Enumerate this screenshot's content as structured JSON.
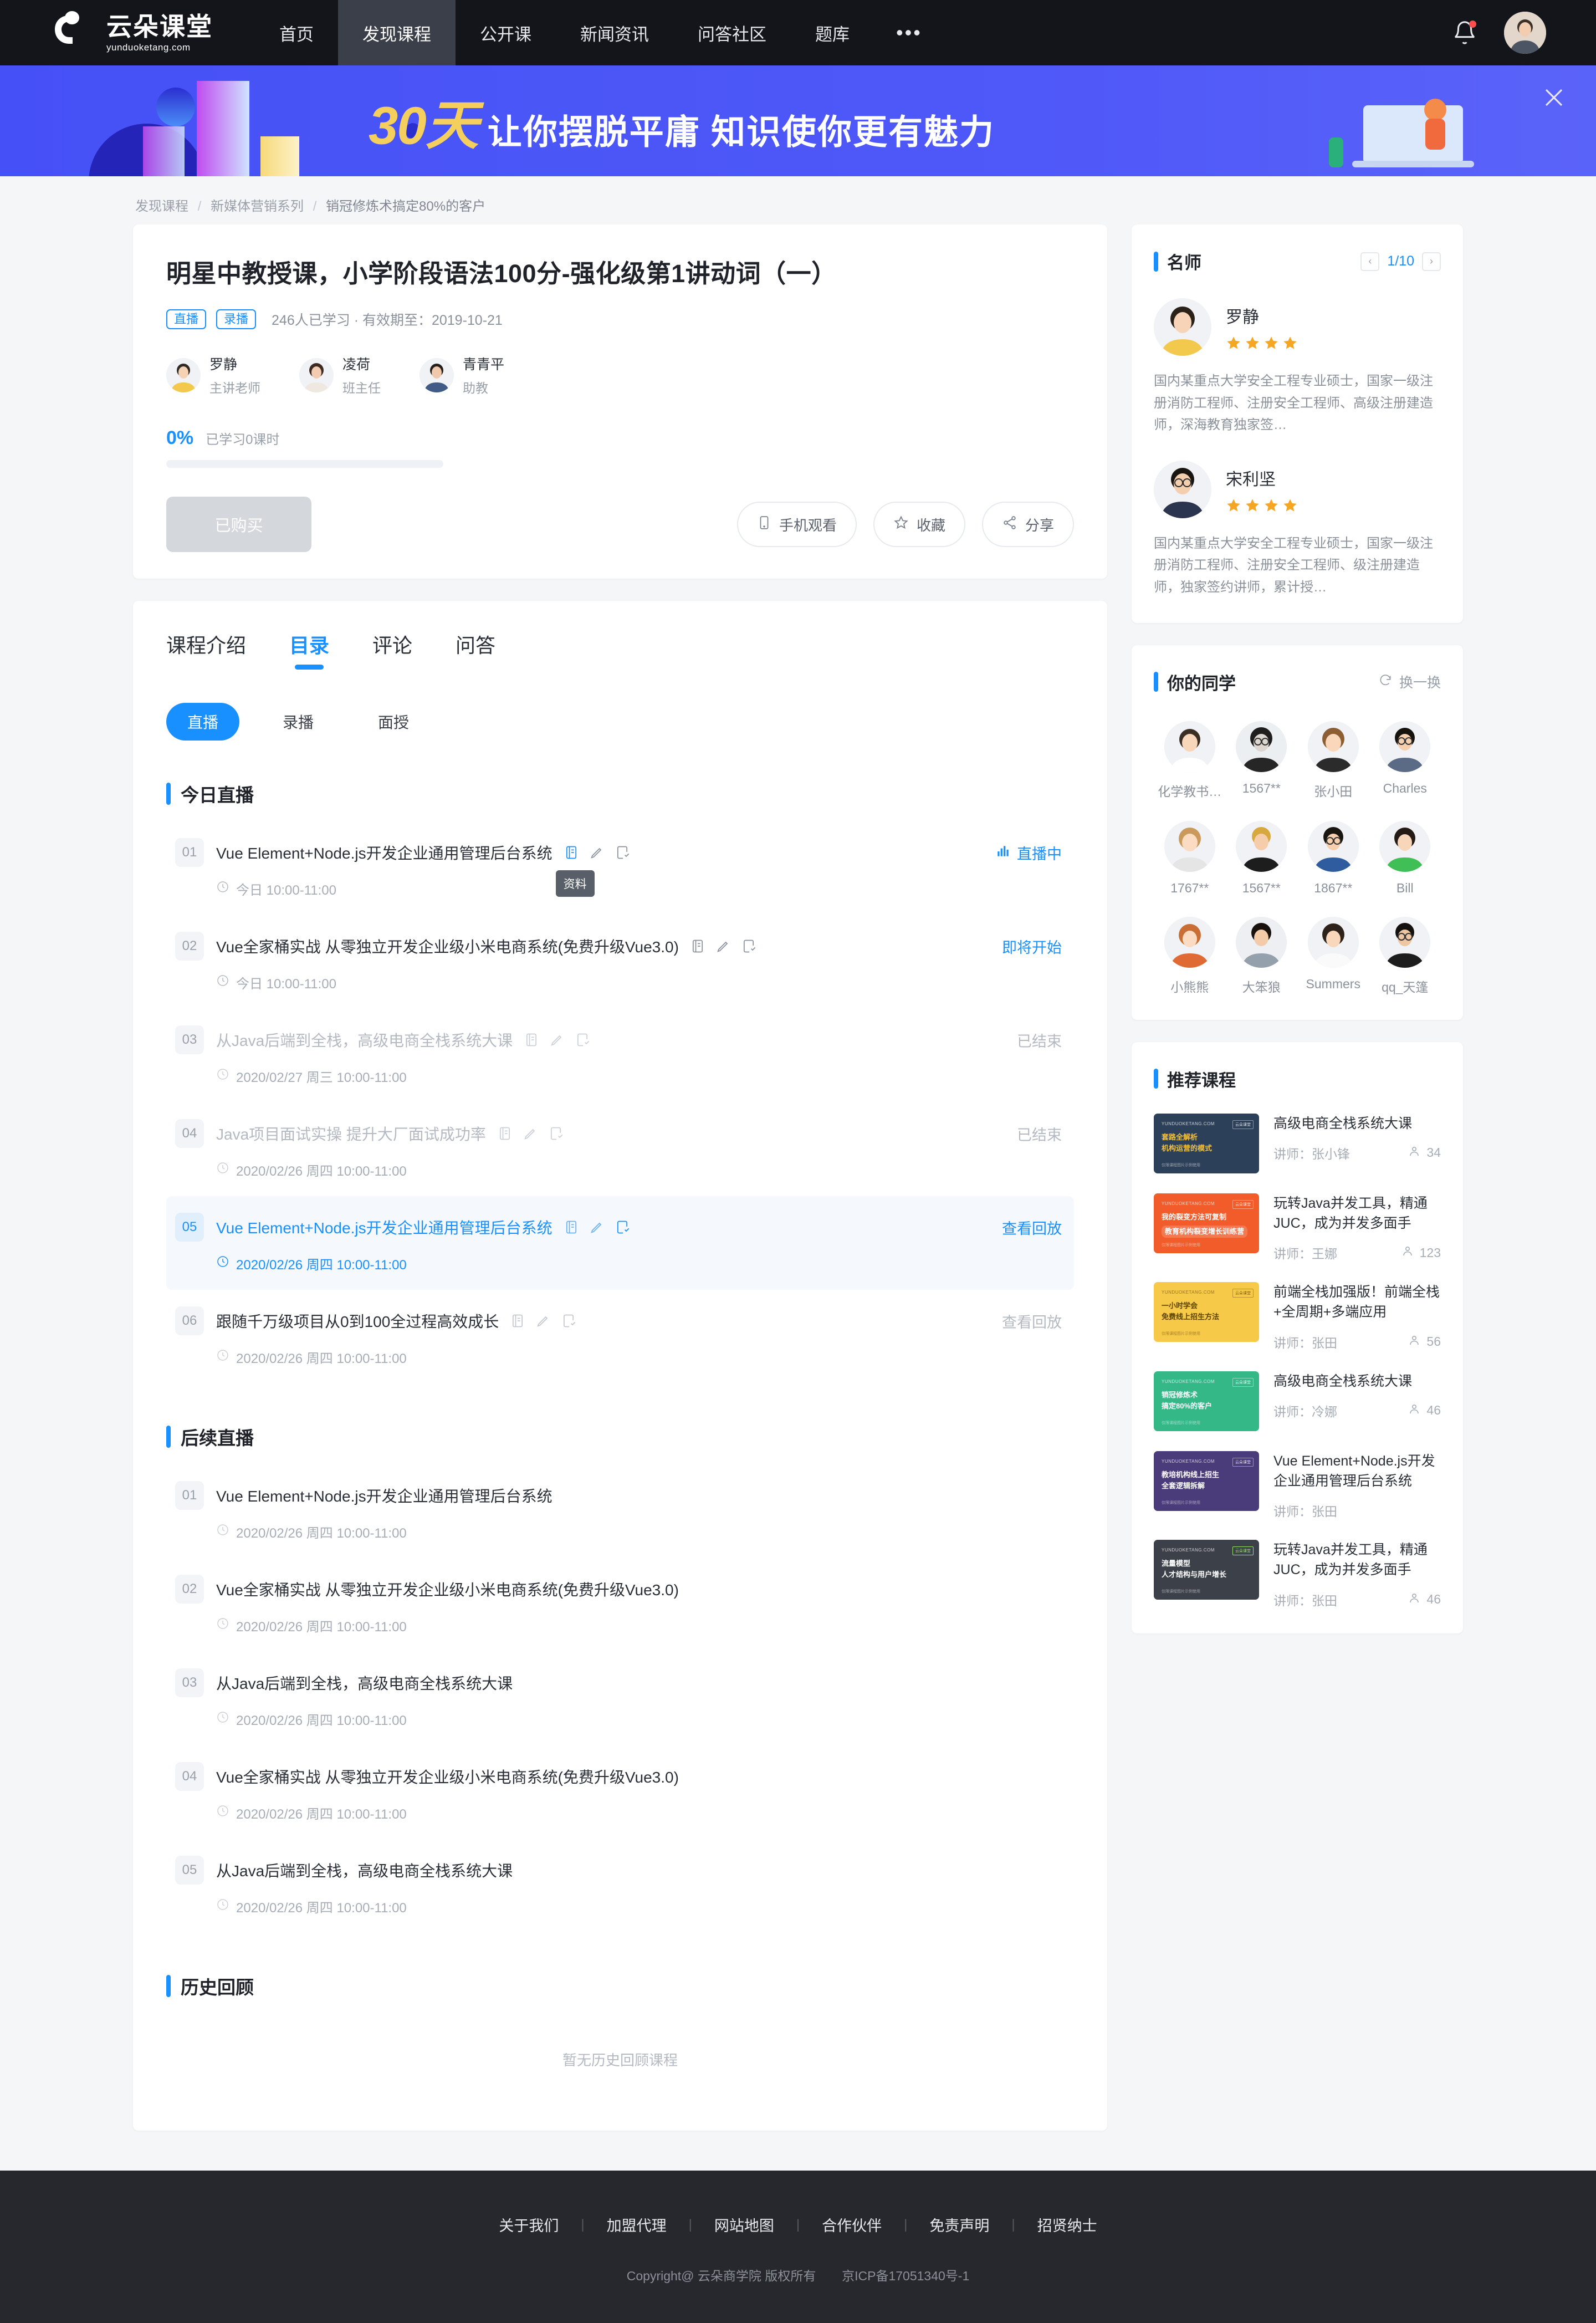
{
  "header": {
    "logo_cn": "云朵课堂",
    "logo_en": "yunduoketang.com",
    "nav": [
      {
        "label": "首页",
        "active": false
      },
      {
        "label": "发现课程",
        "active": true
      },
      {
        "label": "公开课",
        "active": false
      },
      {
        "label": "新闻资讯",
        "active": false
      },
      {
        "label": "问答社区",
        "active": false
      },
      {
        "label": "题库",
        "active": false
      }
    ],
    "more_label": "•••",
    "bell_icon": "bell-icon",
    "avatar_icon": "user-avatar"
  },
  "banner": {
    "highlight": "30天",
    "text": "让你摆脱平庸 知识使你更有魅力",
    "close_icon": "close-icon"
  },
  "breadcrumb": {
    "items": [
      "发现课程",
      "新媒体营销系列",
      "销冠修炼术搞定80%的客户"
    ]
  },
  "course": {
    "title": "明星中教授课，小学阶段语法100分-强化级第1讲动词（一）",
    "tags": [
      "直播",
      "录播"
    ],
    "meta": "246人已学习 · 有效期至：2019-10-21",
    "teachers": [
      {
        "name": "罗静",
        "role": "主讲老师"
      },
      {
        "name": "凌荷",
        "role": "班主任"
      },
      {
        "name": "青青平",
        "role": "助教"
      }
    ],
    "progress_pct": "0%",
    "progress_label": "已学习0课时",
    "progress_value": 0,
    "buy_button": "已购买",
    "actions": [
      {
        "label": "手机观看",
        "icon": "mobile-icon"
      },
      {
        "label": "收藏",
        "icon": "star-icon"
      },
      {
        "label": "分享",
        "icon": "share-icon"
      }
    ]
  },
  "catalog": {
    "tabs": [
      {
        "label": "课程介绍",
        "active": false
      },
      {
        "label": "目录",
        "active": true
      },
      {
        "label": "评论",
        "active": false
      },
      {
        "label": "问答",
        "active": false
      }
    ],
    "pills": [
      {
        "label": "直播",
        "active": true
      },
      {
        "label": "录播",
        "active": false
      },
      {
        "label": "面授",
        "active": false
      }
    ],
    "tooltip": "资料",
    "sections": [
      {
        "title": "今日直播",
        "lessons": [
          {
            "no": "01",
            "title": "Vue Element+Node.js开发企业通用管理后台系统",
            "time": "今日 10:00-11:00",
            "status": "直播中",
            "status_type": "live",
            "icons": true,
            "state": "normal",
            "tooltip": true
          },
          {
            "no": "02",
            "title": "Vue全家桶实战 从零独立开发企业级小米电商系统(免费升级Vue3.0)",
            "time": "今日 10:00-11:00",
            "status": "即将开始",
            "status_type": "soon",
            "icons": true,
            "state": "normal",
            "tooltip": false
          },
          {
            "no": "03",
            "title": "从Java后端到全栈，高级电商全栈系统大课",
            "time": "2020/02/27 周三 10:00-11:00",
            "status": "已结束",
            "status_type": "end",
            "icons": true,
            "state": "muted",
            "tooltip": false
          },
          {
            "no": "04",
            "title": "Java项目面试实操 提升大厂面试成功率",
            "time": "2020/02/26 周四 10:00-11:00",
            "status": "已结束",
            "status_type": "end",
            "icons": true,
            "state": "muted",
            "tooltip": false
          },
          {
            "no": "05",
            "title": "Vue Element+Node.js开发企业通用管理后台系统",
            "time": "2020/02/26 周四 10:00-11:00",
            "status": "查看回放",
            "status_type": "replay",
            "icons": true,
            "state": "hl",
            "tooltip": false
          },
          {
            "no": "06",
            "title": "跟随千万级项目从0到100全过程高效成长",
            "time": "2020/02/26 周四 10:00-11:00",
            "status": "查看回放",
            "status_type": "replay",
            "icons": true,
            "state": "normal",
            "tooltip": false
          }
        ]
      },
      {
        "title": "后续直播",
        "lessons": [
          {
            "no": "01",
            "title": "Vue Element+Node.js开发企业通用管理后台系统",
            "time": "2020/02/26 周四 10:00-11:00",
            "status": "",
            "status_type": "none",
            "icons": false,
            "state": "normal",
            "tooltip": false
          },
          {
            "no": "02",
            "title": "Vue全家桶实战 从零独立开发企业级小米电商系统(免费升级Vue3.0)",
            "time": "2020/02/26 周四 10:00-11:00",
            "status": "",
            "status_type": "none",
            "icons": false,
            "state": "normal",
            "tooltip": false
          },
          {
            "no": "03",
            "title": "从Java后端到全栈，高级电商全栈系统大课",
            "time": "2020/02/26 周四 10:00-11:00",
            "status": "",
            "status_type": "none",
            "icons": false,
            "state": "normal",
            "tooltip": false
          },
          {
            "no": "04",
            "title": "Vue全家桶实战 从零独立开发企业级小米电商系统(免费升级Vue3.0)",
            "time": "2020/02/26 周四 10:00-11:00",
            "status": "",
            "status_type": "none",
            "icons": false,
            "state": "normal",
            "tooltip": false
          },
          {
            "no": "05",
            "title": "从Java后端到全栈，高级电商全栈系统大课",
            "time": "2020/02/26 周四 10:00-11:00",
            "status": "",
            "status_type": "none",
            "icons": false,
            "state": "normal",
            "tooltip": false
          }
        ]
      },
      {
        "title": "历史回顾",
        "lessons": [],
        "empty_text": "暂无历史回顾课程"
      }
    ]
  },
  "sidebar": {
    "mentors": {
      "title": "名师",
      "page": "1/10",
      "prev_icon": "chevron-left-icon",
      "next_icon": "chevron-right-icon",
      "items": [
        {
          "name": "罗静",
          "stars": 4,
          "desc": "国内某重点大学安全工程专业硕士，国家一级注册消防工程师、注册安全工程师、高级注册建造师，深海教育独家签…"
        },
        {
          "name": "宋利坚",
          "stars": 4,
          "desc": "国内某重点大学安全工程专业硕士，国家一级注册消防工程师、注册安全工程师、级注册建造师，独家签约讲师，累计授…"
        }
      ]
    },
    "classmates": {
      "title": "你的同学",
      "refresh_label": "换一换",
      "refresh_icon": "refresh-icon",
      "items": [
        {
          "name": "化学教书…"
        },
        {
          "name": "1567**"
        },
        {
          "name": "张小田"
        },
        {
          "name": "Charles"
        },
        {
          "name": "1767**"
        },
        {
          "name": "1567**"
        },
        {
          "name": "1867**"
        },
        {
          "name": "Bill"
        },
        {
          "name": "小熊熊"
        },
        {
          "name": "大笨狼"
        },
        {
          "name": "Summers"
        },
        {
          "name": "qq_天篷"
        }
      ]
    },
    "recommended": {
      "title": "推荐课程",
      "teacher_prefix": "讲师：",
      "items": [
        {
          "title": "高级电商全栈系统大课",
          "teacher": "张小锋",
          "count": "34",
          "thumb_color": "#2d4059",
          "thumb_line1": "套路全解析",
          "thumb_line2": "机构运营的模式",
          "thumb_accent": "#f0c040"
        },
        {
          "title": "玩转Java并发工具，精通JUC，成为并发多面手",
          "teacher": "王娜",
          "count": "123",
          "thumb_color": "#f25b2a",
          "thumb_line1": "我的裂变方法可复制",
          "thumb_line2": "教育机构裂变增长训练营",
          "thumb_accent": "#ffffff"
        },
        {
          "title": "前端全栈加强版！前端全栈+全周期+多端应用",
          "teacher": "张田",
          "count": "56",
          "thumb_color": "#f7c948",
          "thumb_line1": "一小时学会",
          "thumb_line2": "免费线上招生方法",
          "thumb_accent": "#6b4e00"
        },
        {
          "title": "高级电商全栈系统大课",
          "teacher": "冷娜",
          "count": "46",
          "thumb_color": "#34b888",
          "thumb_line1": "销冠修炼术",
          "thumb_line2": "搞定80%的客户",
          "thumb_accent": "#ffffff"
        },
        {
          "title": "Vue Element+Node.js开发企业通用管理后台系统",
          "teacher": "张田",
          "count": "",
          "thumb_color": "#4a3c7a",
          "thumb_line1": "教培机构线上招生",
          "thumb_line2": "全套逻辑拆解",
          "thumb_accent": "#ffffff"
        },
        {
          "title": "玩转Java并发工具，精通JUC，成为并发多面手",
          "teacher": "张田",
          "count": "46",
          "thumb_color": "#3b4049",
          "thumb_line1": "流量模型",
          "thumb_line2": "人才结构与用户增长",
          "thumb_accent": "#ffffff"
        }
      ]
    }
  },
  "footer": {
    "links": [
      "关于我们",
      "加盟代理",
      "网站地图",
      "合作伙伴",
      "免责声明",
      "招贤纳士"
    ],
    "copyright": "Copyright@ 云朵商学院   版权所有",
    "icp": "京ICP备17051340号-1"
  }
}
